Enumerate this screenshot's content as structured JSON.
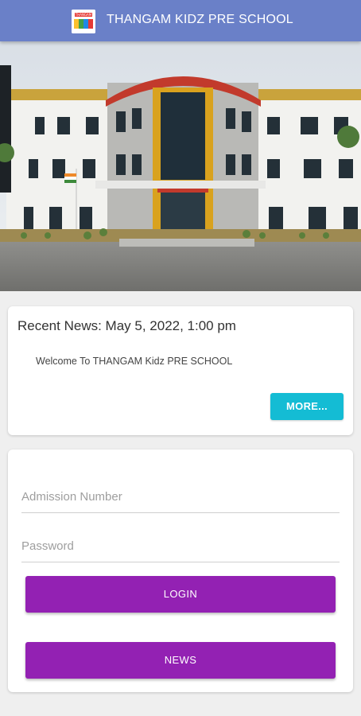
{
  "app_bar": {
    "title": "THANGAM KIDZ PRE SCHOOL",
    "logo_icon": "thangam-kidz-logo"
  },
  "hero": {
    "image": "school-building-photo"
  },
  "news_card": {
    "heading": "Recent News: May 5, 2022, 1:00 pm",
    "body": "Welcome To THANGAM Kidz PRE SCHOOL",
    "more_label": "MORE..."
  },
  "login_card": {
    "admission_placeholder": "Admission Number",
    "admission_value": "",
    "password_placeholder": "Password",
    "password_value": "",
    "login_label": "LOGIN",
    "news_label": "NEWS"
  },
  "colors": {
    "app_bar": "#6a80c8",
    "more_button": "#14bcd4",
    "primary_button": "#9321b3",
    "background": "#efefef"
  }
}
